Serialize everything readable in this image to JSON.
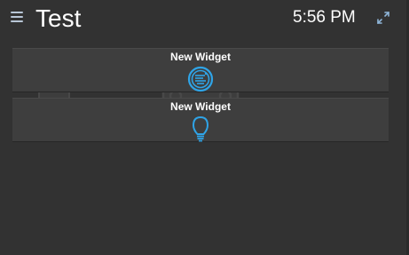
{
  "header": {
    "title": "Test",
    "time": "5:56 PM",
    "menu_icon": "menu-icon",
    "fullscreen_icon": "fullscreen-icon"
  },
  "widgets": [
    {
      "label": "New Widget",
      "icon": "washing-machine-icon"
    },
    {
      "label": "New Widget",
      "icon": "light-bulb-icon"
    }
  ],
  "colors": {
    "background": "#323232",
    "widget_background": "#3e3e3e",
    "accent": "#2fa4e7",
    "text": "#ffffff"
  }
}
